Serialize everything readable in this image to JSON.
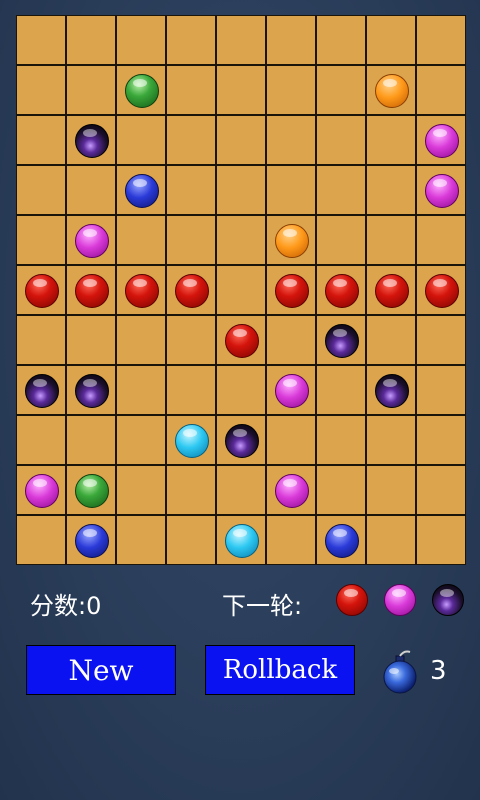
{
  "board": {
    "rows": 11,
    "cols": 9,
    "balls": [
      {
        "row": 1,
        "col": 2,
        "color": "green"
      },
      {
        "row": 1,
        "col": 7,
        "color": "orange"
      },
      {
        "row": 2,
        "col": 1,
        "color": "black"
      },
      {
        "row": 2,
        "col": 8,
        "color": "purple"
      },
      {
        "row": 3,
        "col": 2,
        "color": "blue"
      },
      {
        "row": 3,
        "col": 8,
        "color": "purple"
      },
      {
        "row": 4,
        "col": 1,
        "color": "purple"
      },
      {
        "row": 4,
        "col": 5,
        "color": "orange"
      },
      {
        "row": 5,
        "col": 0,
        "color": "red"
      },
      {
        "row": 5,
        "col": 1,
        "color": "red"
      },
      {
        "row": 5,
        "col": 2,
        "color": "red"
      },
      {
        "row": 5,
        "col": 3,
        "color": "red"
      },
      {
        "row": 5,
        "col": 5,
        "color": "red"
      },
      {
        "row": 5,
        "col": 6,
        "color": "red"
      },
      {
        "row": 5,
        "col": 7,
        "color": "red"
      },
      {
        "row": 5,
        "col": 8,
        "color": "red"
      },
      {
        "row": 6,
        "col": 4,
        "color": "red"
      },
      {
        "row": 6,
        "col": 6,
        "color": "black"
      },
      {
        "row": 7,
        "col": 0,
        "color": "black"
      },
      {
        "row": 7,
        "col": 1,
        "color": "black"
      },
      {
        "row": 7,
        "col": 5,
        "color": "purple"
      },
      {
        "row": 7,
        "col": 7,
        "color": "black"
      },
      {
        "row": 8,
        "col": 3,
        "color": "cyan"
      },
      {
        "row": 8,
        "col": 4,
        "color": "black"
      },
      {
        "row": 9,
        "col": 0,
        "color": "purple"
      },
      {
        "row": 9,
        "col": 1,
        "color": "green"
      },
      {
        "row": 9,
        "col": 5,
        "color": "purple"
      },
      {
        "row": 10,
        "col": 1,
        "color": "blue"
      },
      {
        "row": 10,
        "col": 4,
        "color": "cyan"
      },
      {
        "row": 10,
        "col": 6,
        "color": "blue"
      }
    ]
  },
  "score": {
    "label": "分数:0"
  },
  "next_round": {
    "label": "下一轮:",
    "balls": [
      "red",
      "purple",
      "black"
    ]
  },
  "buttons": {
    "new_label": "New",
    "rollback_label": "Rollback"
  },
  "bomb": {
    "count": "3"
  },
  "colors": {
    "background": "#2b3f5c",
    "board": "#dca44c",
    "button": "#0a12f2"
  }
}
